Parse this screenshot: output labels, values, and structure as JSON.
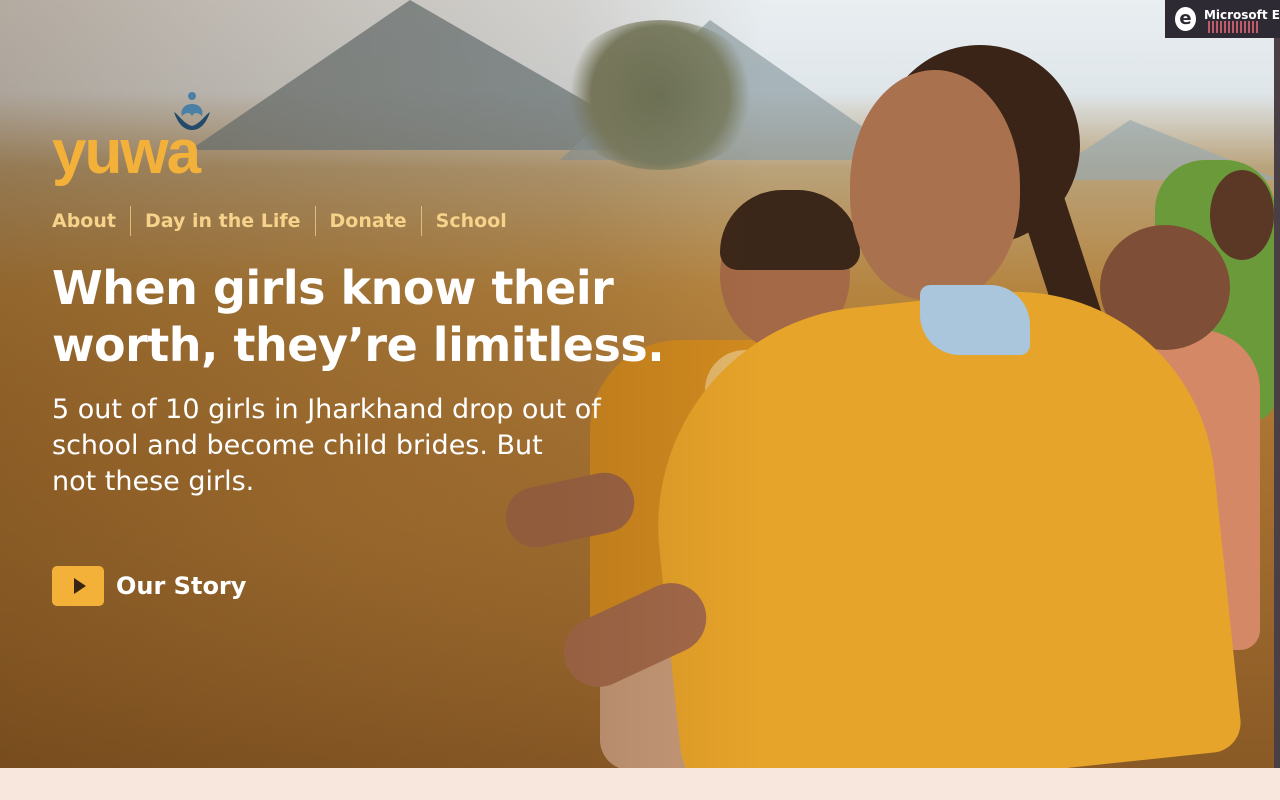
{
  "brand": {
    "logo_text": "yuwa",
    "accent_color": "#f4b13a",
    "lotus_color": "#234a6b"
  },
  "nav": {
    "items": [
      {
        "label": "About"
      },
      {
        "label": "Day in the Life"
      },
      {
        "label": "Donate"
      },
      {
        "label": "School"
      }
    ]
  },
  "hero": {
    "headline_line1": "When girls know their",
    "headline_line2": "worth, they’re limitless.",
    "subhead_line1": "5 out of 10 girls in Jharkhand drop out of",
    "subhead_line2": "school and become child brides. But",
    "subhead_line3": "not these girls.",
    "cta_label": "Our Story",
    "cta_icon": "play-icon"
  },
  "browser_badge": {
    "label": "Microsoft E",
    "icon": "edge-browser-icon"
  },
  "colors": {
    "page_background": "#f8e7dc",
    "nav_text": "#f7d28a",
    "hero_text": "#ffffff"
  }
}
